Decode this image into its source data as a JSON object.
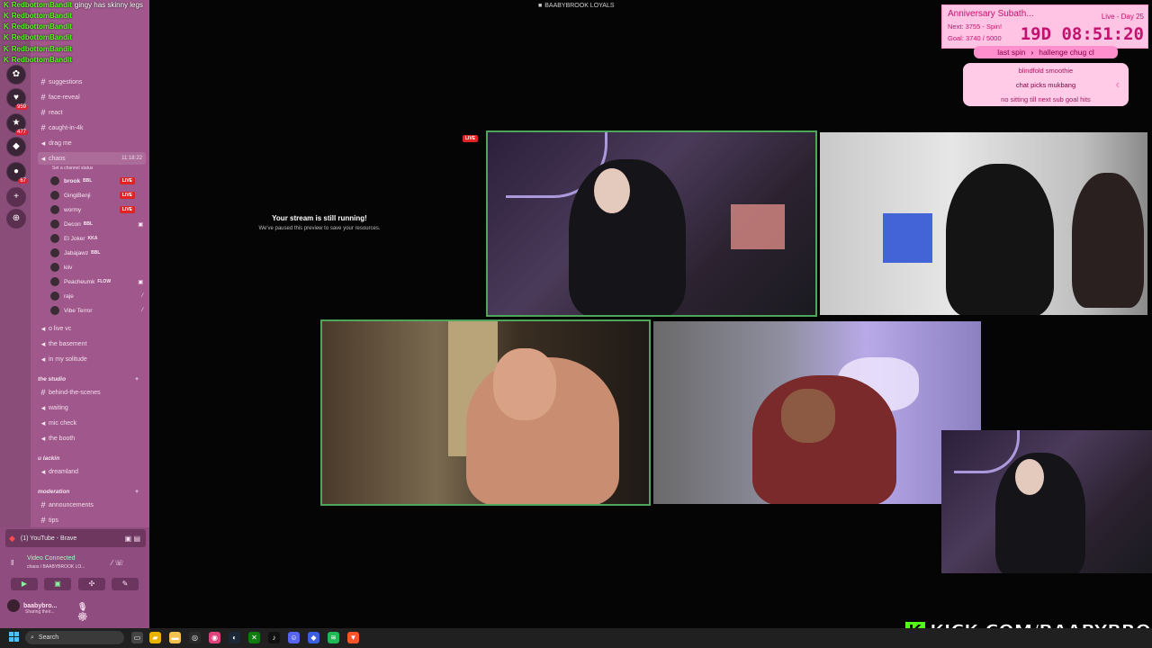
{
  "chat": [
    {
      "user": "RedbottomBandit",
      "message": "gingy has skinny legs"
    },
    {
      "user": "RedbottomBandit",
      "message": ""
    },
    {
      "user": "RedbottomBandit",
      "message": ""
    },
    {
      "user": "RedbottomBandit",
      "message": ""
    },
    {
      "user": "RedbottomBandit",
      "message": ""
    },
    {
      "user": "RedbottomBandit",
      "message": ""
    }
  ],
  "app_title": "BAABYBROOK LOYALS",
  "sidebar": {
    "channels_top": [
      {
        "name": "suggestions"
      },
      {
        "name": "face-reveal"
      },
      {
        "name": "react"
      },
      {
        "name": "caught-in-4k"
      },
      {
        "name": "drag me"
      }
    ],
    "active_voice": {
      "name": "chaos",
      "time": "11:18:22",
      "status": "Set a channel status"
    },
    "voice_users": [
      {
        "name": "brook",
        "tag": "BBL",
        "live": true
      },
      {
        "name": "GingiBenji",
        "tag": "",
        "live": true
      },
      {
        "name": "wormy",
        "tag": "",
        "live": true
      },
      {
        "name": "Decon",
        "tag": "BBL",
        "live": false
      },
      {
        "name": "El Joker",
        "tag": "KKA",
        "live": false
      },
      {
        "name": "Jabajawz",
        "tag": "BBL",
        "live": false
      },
      {
        "name": "kiiv",
        "tag": "",
        "live": false
      },
      {
        "name": "Peacheumk",
        "tag": "FLOW",
        "live": false
      },
      {
        "name": "raje",
        "tag": "",
        "live": false
      },
      {
        "name": "Vibe Terror",
        "tag": "",
        "live": false
      }
    ],
    "channels_mid": [
      {
        "name": "o live vc"
      },
      {
        "name": "the basement"
      },
      {
        "name": "in my solitude"
      }
    ],
    "category_studio": "the studio",
    "channels_studio": [
      {
        "name": "behind-the-scenes"
      },
      {
        "name": "waiting"
      },
      {
        "name": "mic check"
      },
      {
        "name": "the booth"
      }
    ],
    "category_lackin": "u lackin",
    "channels_lackin": [
      {
        "name": "dreamland"
      }
    ],
    "category_mod": "moderation",
    "channels_mod": [
      {
        "name": "announcements"
      },
      {
        "name": "tips"
      }
    ]
  },
  "voice_panel": {
    "activity": "(1) YouTube - Brave",
    "connection": "Video Connected",
    "channel_path": "chaos / BAABYBROOK LO...",
    "username": "baabybro...",
    "status": "Sharing their..."
  },
  "stream_notice": {
    "live": "LIVE",
    "title": "Your stream is still running!",
    "subtitle": "We've paused this preview to save your resources."
  },
  "subathon": {
    "title": "Anniversary Subath...",
    "day": "Live - Day 25",
    "next": "Next: 3755 - Spin!",
    "goal": "Goal: 3740 / 5000",
    "timer": "19D 08:51:20"
  },
  "spin": {
    "last": "last spin",
    "current": "hallenge chug cl"
  },
  "wheel_items": [
    "blindfold smoothie",
    "chat picks mukbang",
    "no sitting till next sub goal hits"
  ],
  "kick_url": "KICK.COM/BAABYBROOK",
  "taskbar": {
    "search_placeholder": "Search"
  },
  "colors": {
    "accent_pink": "#c2116e",
    "kick_green": "#53fc18",
    "sidebar": "#a0588c",
    "live_red": "#e02424"
  }
}
